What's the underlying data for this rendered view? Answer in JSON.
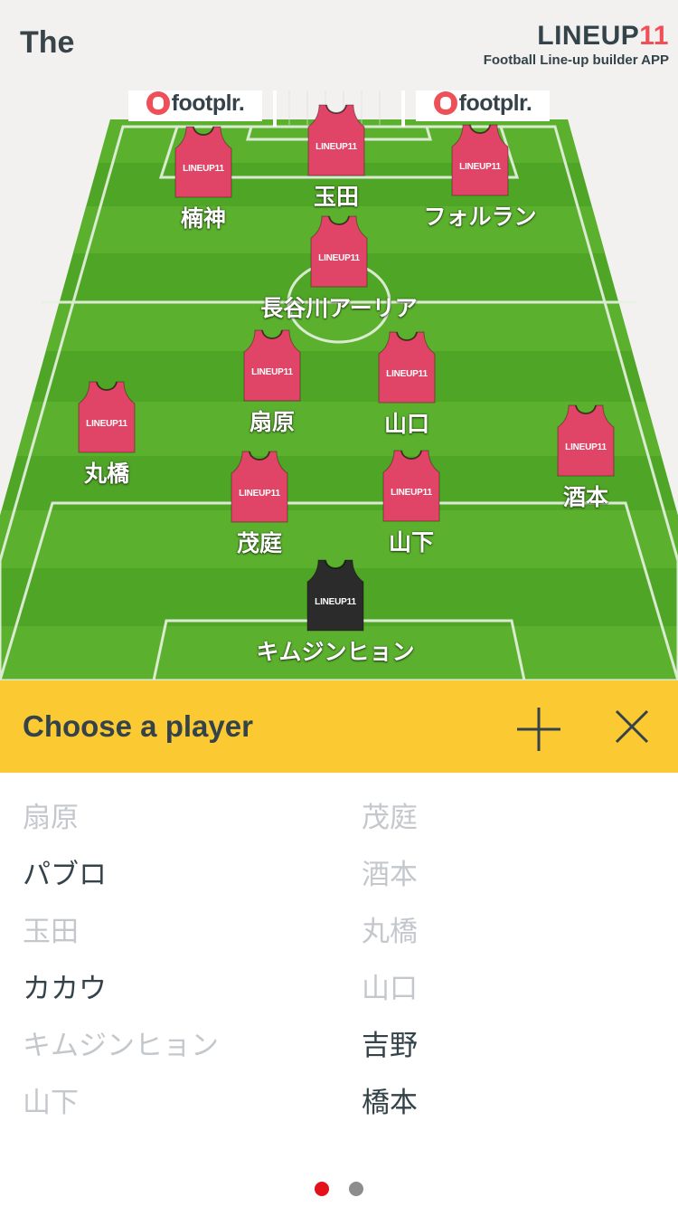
{
  "header": {
    "team_title": "The",
    "brand_name": "LINEUP",
    "brand_number": "11",
    "brand_tagline": "Football Line-up builder APP"
  },
  "sponsors": [
    {
      "label": "footplr."
    },
    {
      "label": "footplr."
    }
  ],
  "jersey_brand": "LINEUP11",
  "colors": {
    "grass_light": "#5cb22f",
    "grass_dark": "#4a9f22",
    "jersey": "#e04466",
    "goalkeeper_jersey": "#2b2b2b",
    "chooser_bar": "#fbc931",
    "brand_accent": "#ee4f59",
    "text_dark": "#34434a",
    "text_muted": "#c4c8cc",
    "pager_active": "#e31119",
    "pager_inactive": "#8d8d8d"
  },
  "players": [
    {
      "name": "楠神",
      "role": "forward"
    },
    {
      "name": "玉田",
      "role": "forward"
    },
    {
      "name": "フォルラン",
      "role": "forward"
    },
    {
      "name": "長谷川アーリア",
      "role": "midfielder"
    },
    {
      "name": "扇原",
      "role": "midfielder"
    },
    {
      "name": "山口",
      "role": "midfielder"
    },
    {
      "name": "丸橋",
      "role": "defender"
    },
    {
      "name": "酒本",
      "role": "defender"
    },
    {
      "name": "茂庭",
      "role": "defender"
    },
    {
      "name": "山下",
      "role": "defender"
    },
    {
      "name": "キムジンヒョン",
      "role": "goalkeeper"
    }
  ],
  "chooser": {
    "title": "Choose a player",
    "add_icon": "plus-icon",
    "close_icon": "close-icon"
  },
  "roster": [
    {
      "name": "扇原",
      "in_lineup": true
    },
    {
      "name": "茂庭",
      "in_lineup": true
    },
    {
      "name": "パブロ",
      "in_lineup": false
    },
    {
      "name": "酒本",
      "in_lineup": true
    },
    {
      "name": "玉田",
      "in_lineup": true
    },
    {
      "name": "丸橋",
      "in_lineup": true
    },
    {
      "name": "カカウ",
      "in_lineup": false
    },
    {
      "name": "山口",
      "in_lineup": true
    },
    {
      "name": "キムジンヒョン",
      "in_lineup": true
    },
    {
      "name": "吉野",
      "in_lineup": false
    },
    {
      "name": "山下",
      "in_lineup": true
    },
    {
      "name": "橋本",
      "in_lineup": false
    }
  ],
  "pager": {
    "pages": 2,
    "current": 1
  }
}
